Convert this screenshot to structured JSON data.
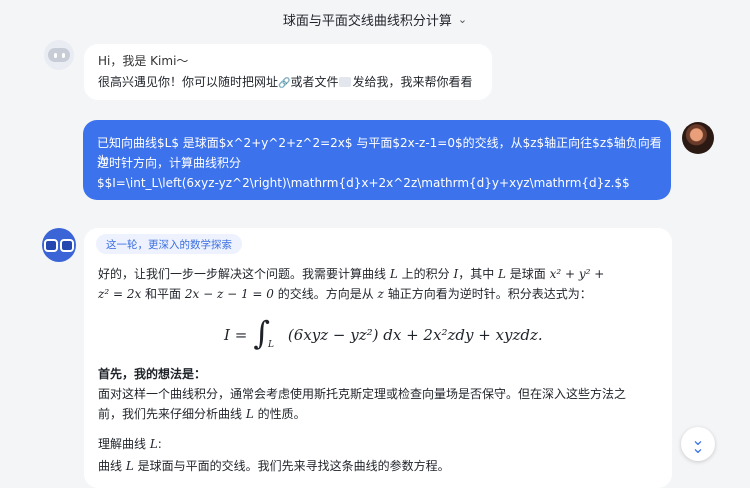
{
  "header": {
    "title": "球面与平面交线曲线积分计算",
    "chevron": "chevron-down-icon"
  },
  "greeting": {
    "line1": "Hi，我是 Kimi～",
    "line2_part1": "很高兴遇见你！你可以随时把网址",
    "line2_link_icon": "🔗",
    "line2_part2": "或者文件",
    "line2_part3": "发给我，我来帮你看看"
  },
  "user_message": {
    "line1": "已知向曲线$L$ 是球面$x^2+y^2+z^2=2x$ 与平面$2x-z-1=0$的交线，从$z$轴正向往$z$轴负向看为",
    "line2": "逆时针方向，计算曲线积分",
    "line3": "$$I=\\int_L\\left(6xyz-yz^2\\right)\\mathrm{d}x+2x^2z\\mathrm{d}y+xyz\\mathrm{d}z.$$"
  },
  "answer": {
    "tag": "这一轮，更深入的数学探索",
    "intro_a": "好的，让我们一步一步解决这个问题。我需要计算曲线 ",
    "intro_L": "L",
    "intro_b": " 上的积分 ",
    "intro_I": "I",
    "intro_c": "，其中 ",
    "intro_L2": "L",
    "intro_d": " 是球面 ",
    "intro_sphere1": "x² + y² +",
    "intro_sphere2": "z² = 2x",
    "intro_e": " 和平面 ",
    "intro_plane": "2x − z − 1 = 0",
    "intro_f": " 的交线。方向是从 ",
    "intro_z": "z",
    "intro_g": " 轴正方向看为逆时针。积分表达式为：",
    "formula_lhs": "I =",
    "formula_int": "∫",
    "formula_sub": "L",
    "formula_rhs": "(6xyz − yz²) dx + 2x²zdy + xyzdz.",
    "heading1": "首先，我的想法是：",
    "para1_line1": "面对这样一个曲线积分，通常会考虑使用斯托克斯定理或检查向量场是否保守。但在深入这些方法之",
    "para1_line2a": "前，我们先来仔细分析曲线 ",
    "para1_L": "L",
    "para1_line2b": " 的性质。",
    "heading2a": "理解曲线 ",
    "heading2_L": "L",
    "heading2b": ":",
    "para2a": "曲线 ",
    "para2_L": "L",
    "para2b": " 是球面与平面的交线。我们先来寻找这条曲线的参数方程。"
  },
  "scroll_button": {
    "icon": "double-chevron-down-icon",
    "glyph": "⌄"
  }
}
